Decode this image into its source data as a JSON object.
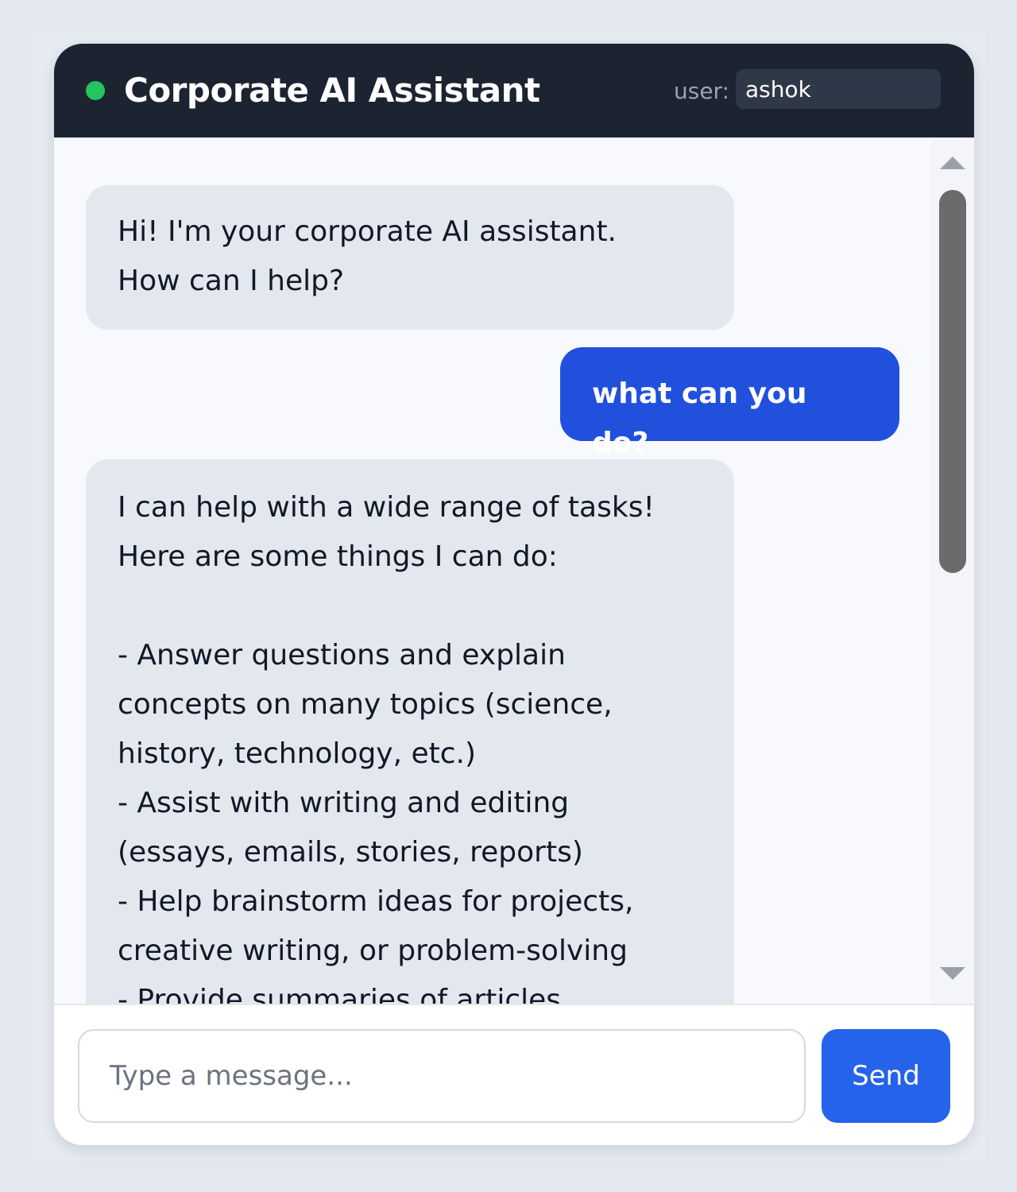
{
  "header": {
    "title": "Corporate AI Assistant",
    "status_color": "#22c55e",
    "user_label": "user:",
    "user_value": "ashok"
  },
  "messages": [
    {
      "role": "assistant",
      "text": "Hi! I'm your corporate AI assistant.\nHow can I help?"
    },
    {
      "role": "user",
      "text": "what can you do?"
    },
    {
      "role": "assistant",
      "text": "I can help with a wide range of tasks!\nHere are some things I can do:\n\n- Answer questions and explain\nconcepts on many topics (science,\nhistory, technology, etc.)\n- Assist with writing and editing\n(essays, emails, stories, reports)\n- Help brainstorm ideas for projects,\ncreative writing, or problem-solving\n- Provide summaries of articles"
    }
  ],
  "composer": {
    "placeholder": "Type a message...",
    "value": "",
    "send_label": "Send"
  },
  "colors": {
    "header_bg": "#1c2432",
    "user_bubble": "#2150dd",
    "assistant_bubble": "#e3e8ef",
    "send_button": "#2563eb"
  }
}
